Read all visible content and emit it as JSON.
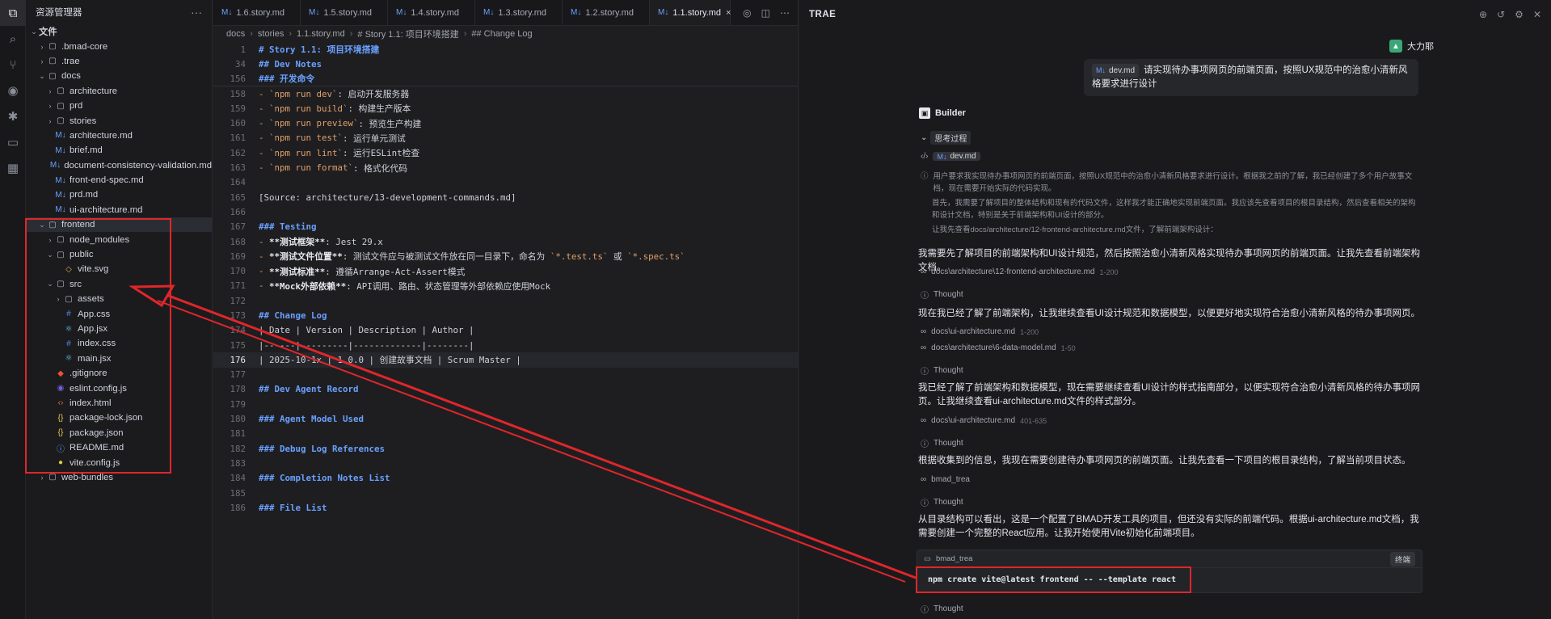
{
  "explorer": {
    "title": "资源管理器",
    "more": "···",
    "rows": [
      {
        "label": "文件",
        "indent": 0,
        "kind": "section",
        "chev": "⌄"
      },
      {
        "label": ".bmad-core",
        "indent": 1,
        "kind": "folder",
        "chev": "›"
      },
      {
        "label": ".trae",
        "indent": 1,
        "kind": "folder",
        "chev": "›"
      },
      {
        "label": "docs",
        "indent": 1,
        "kind": "folder",
        "chev": "⌄"
      },
      {
        "label": "architecture",
        "indent": 2,
        "kind": "folder",
        "chev": "›"
      },
      {
        "label": "prd",
        "indent": 2,
        "kind": "folder",
        "chev": "›"
      },
      {
        "label": "stories",
        "indent": 2,
        "kind": "folder",
        "chev": "›"
      },
      {
        "label": "architecture.md",
        "indent": 2,
        "kind": "md",
        "chev": ""
      },
      {
        "label": "brief.md",
        "indent": 2,
        "kind": "md",
        "chev": ""
      },
      {
        "label": "document-consistency-validation.md",
        "indent": 2,
        "kind": "md",
        "chev": ""
      },
      {
        "label": "front-end-spec.md",
        "indent": 2,
        "kind": "md",
        "chev": ""
      },
      {
        "label": "prd.md",
        "indent": 2,
        "kind": "md",
        "chev": ""
      },
      {
        "label": "ui-architecture.md",
        "indent": 2,
        "kind": "md",
        "chev": ""
      },
      {
        "label": "frontend",
        "indent": 1,
        "kind": "folder",
        "chev": "⌄",
        "selected": true
      },
      {
        "label": "node_modules",
        "indent": 2,
        "kind": "folder",
        "chev": "›"
      },
      {
        "label": "public",
        "indent": 2,
        "kind": "folder",
        "chev": "⌄"
      },
      {
        "label": "vite.svg",
        "indent": 3,
        "kind": "svg",
        "chev": ""
      },
      {
        "label": "src",
        "indent": 2,
        "kind": "folder",
        "chev": "⌄"
      },
      {
        "label": "assets",
        "indent": 3,
        "kind": "folder",
        "chev": "›"
      },
      {
        "label": "App.css",
        "indent": 3,
        "kind": "css",
        "chev": ""
      },
      {
        "label": "App.jsx",
        "indent": 3,
        "kind": "jsx",
        "chev": ""
      },
      {
        "label": "index.css",
        "indent": 3,
        "kind": "css",
        "chev": ""
      },
      {
        "label": "main.jsx",
        "indent": 3,
        "kind": "jsx",
        "chev": ""
      },
      {
        "label": ".gitignore",
        "indent": 2,
        "kind": "git",
        "chev": ""
      },
      {
        "label": "eslint.config.js",
        "indent": 2,
        "kind": "es",
        "chev": ""
      },
      {
        "label": "index.html",
        "indent": 2,
        "kind": "html",
        "chev": ""
      },
      {
        "label": "package-lock.json",
        "indent": 2,
        "kind": "json",
        "chev": ""
      },
      {
        "label": "package.json",
        "indent": 2,
        "kind": "json",
        "chev": ""
      },
      {
        "label": "README.md",
        "indent": 2,
        "kind": "info",
        "chev": ""
      },
      {
        "label": "vite.config.js",
        "indent": 2,
        "kind": "js",
        "chev": ""
      },
      {
        "label": "web-bundles",
        "indent": 1,
        "kind": "folder",
        "chev": "›"
      }
    ]
  },
  "editor": {
    "tabs": [
      "1.6.story.md",
      "1.5.story.md",
      "1.4.story.md",
      "1.3.story.md",
      "1.2.story.md",
      "1.1.story.md"
    ],
    "active_tab": 5,
    "tab_close": "×",
    "breadcrumbs": [
      "docs",
      "stories",
      "1.1.story.md",
      "# Story 1.1: 项目环境搭建",
      "## Change Log"
    ],
    "lines": [
      {
        "n": "1",
        "parts": [
          [
            "h",
            "# Story 1.1: 项目环境搭建"
          ]
        ]
      },
      {
        "n": "34",
        "parts": [
          [
            "h",
            "## Dev Notes"
          ]
        ]
      },
      {
        "n": "156",
        "parts": [
          [
            "h",
            "### 开发命令"
          ]
        ]
      },
      {
        "n": "158",
        "parts": [
          [
            "dash",
            "- "
          ],
          [
            "cd",
            "`npm run dev`"
          ],
          [
            "t",
            ": 启动开发服务器"
          ]
        ]
      },
      {
        "n": "159",
        "parts": [
          [
            "dash",
            "- "
          ],
          [
            "cd",
            "`npm run build`"
          ],
          [
            "t",
            ": 构建生产版本"
          ]
        ]
      },
      {
        "n": "160",
        "parts": [
          [
            "dash",
            "- "
          ],
          [
            "cd",
            "`npm run preview`"
          ],
          [
            "t",
            ": 预览生产构建"
          ]
        ]
      },
      {
        "n": "161",
        "parts": [
          [
            "dash",
            "- "
          ],
          [
            "cd",
            "`npm run test`"
          ],
          [
            "t",
            ": 运行单元测试"
          ]
        ]
      },
      {
        "n": "162",
        "parts": [
          [
            "dash",
            "- "
          ],
          [
            "cd",
            "`npm run lint`"
          ],
          [
            "t",
            ": 运行ESLint检查"
          ]
        ]
      },
      {
        "n": "163",
        "parts": [
          [
            "dash",
            "- "
          ],
          [
            "cd",
            "`npm run format`"
          ],
          [
            "t",
            ": 格式化代码"
          ]
        ]
      },
      {
        "n": "164",
        "parts": []
      },
      {
        "n": "165",
        "parts": [
          [
            "t",
            "[Source: architecture/13-development-commands.md]"
          ]
        ]
      },
      {
        "n": "166",
        "parts": []
      },
      {
        "n": "167",
        "parts": [
          [
            "h",
            "### Testing"
          ]
        ]
      },
      {
        "n": "168",
        "parts": [
          [
            "dash",
            "- "
          ],
          [
            "bold",
            "**测试框架**"
          ],
          [
            "t",
            ": Jest 29.x"
          ]
        ]
      },
      {
        "n": "169",
        "parts": [
          [
            "dash",
            "- "
          ],
          [
            "bold",
            "**测试文件位置**"
          ],
          [
            "t",
            ": 测试文件应与被测试文件放在同一目录下，命名为 "
          ],
          [
            "cd",
            "`*.test.ts`"
          ],
          [
            "t",
            " 或 "
          ],
          [
            "cd",
            "`*.spec.ts`"
          ]
        ]
      },
      {
        "n": "170",
        "parts": [
          [
            "dash",
            "- "
          ],
          [
            "bold",
            "**测试标准**"
          ],
          [
            "t",
            ": 遵循Arrange-Act-Assert模式"
          ]
        ]
      },
      {
        "n": "171",
        "parts": [
          [
            "dash",
            "- "
          ],
          [
            "bold",
            "**Mock外部依赖**"
          ],
          [
            "t",
            ": API调用、路由、状态管理等外部依赖应使用Mock"
          ]
        ]
      },
      {
        "n": "172",
        "parts": []
      },
      {
        "n": "173",
        "parts": [
          [
            "h",
            "## Change Log"
          ]
        ]
      },
      {
        "n": "174",
        "parts": [
          [
            "t",
            "| Date | Version | Description | Author |"
          ]
        ]
      },
      {
        "n": "175",
        "parts": [
          [
            "t",
            "|------|---------|-------------|--------|"
          ]
        ]
      },
      {
        "n": "176",
        "parts": [
          [
            "t",
            "| 2025-10-1x | 1.0.0 | 创建故事文档 | Scrum Master |"
          ]
        ],
        "current": true
      },
      {
        "n": "177",
        "parts": []
      },
      {
        "n": "178",
        "parts": [
          [
            "h",
            "## Dev Agent Record"
          ]
        ]
      },
      {
        "n": "179",
        "parts": []
      },
      {
        "n": "180",
        "parts": [
          [
            "h",
            "### Agent Model Used"
          ]
        ]
      },
      {
        "n": "181",
        "parts": []
      },
      {
        "n": "182",
        "parts": [
          [
            "h",
            "### Debug Log References"
          ]
        ]
      },
      {
        "n": "183",
        "parts": []
      },
      {
        "n": "184",
        "parts": [
          [
            "h",
            "### Completion Notes List"
          ]
        ]
      },
      {
        "n": "185",
        "parts": []
      },
      {
        "n": "186",
        "parts": [
          [
            "h",
            "### File List"
          ]
        ]
      }
    ]
  },
  "chat": {
    "title": "TRAE",
    "user": {
      "name": "大力耶",
      "file_chip": "dev.md",
      "message": "请实现待办事项网页的前端页面，按照UX规范中的治愈小清新风格要求进行设计"
    },
    "bot_name": "Builder",
    "thinking_label": "思考过程",
    "thinking_file": "dev.md",
    "thinking_1": "用户要求我实现待办事项网页的前端页面，按照UX规范中的治愈小清新风格要求进行设计。根据我之前的了解，我已经创建了多个用户故事文档，现在需要开始实际的代码实现。",
    "thinking_2": "首先，我需要了解项目的整体结构和现有的代码文件，这样我才能正确地实现前端页面。我应该先查看项目的根目录结构，然后查看相关的架构和设计文档，特别是关于前端架构和UI设计的部分。",
    "thinking_3": "让我先查看docs/architecture/12-frontend-architecture.md文件，了解前端架构设计：",
    "p1": "我需要先了解项目的前端架构和UI设计规范，然后按照治愈小清新风格实现待办事项网页的前端页面。让我先查看前端架构文档。",
    "ref1": "docs\\architecture\\12-frontend-architecture.md",
    "ref1_sub": "1-200",
    "thought": "Thought",
    "p2": "现在我已经了解了前端架构，让我继续查看UI设计规范和数据模型，以便更好地实现符合治愈小清新风格的待办事项网页。",
    "ref2": "docs\\ui-architecture.md",
    "ref2_sub": "1-200",
    "ref3": "docs\\architecture\\6-data-model.md",
    "ref3_sub": "1-50",
    "p3": "我已经了解了前端架构和数据模型，现在需要继续查看UI设计的样式指南部分，以便实现符合治愈小清新风格的待办事项网页。让我继续查看ui-architecture.md文件的样式部分。",
    "ref4": "docs\\ui-architecture.md",
    "ref4_sub": "401-635",
    "p4": "根据收集到的信息，我现在需要创建待办事项网页的前端页面。让我先查看一下项目的根目录结构，了解当前项目状态。",
    "ref5": "bmad_trea",
    "p5": "从目录结构可以看出，这是一个配置了BMAD开发工具的项目，但还没有实际的前端代码。根据ui-architecture.md文档，我需要创建一个完整的React应用。让我开始使用Vite初始化前端项目。",
    "terminal_name": "bmad_trea",
    "terminal_button": "终端",
    "command": "npm create vite@latest frontend -- --template react"
  },
  "colors": {
    "annotation_red": "#e0262a",
    "accent_blue": "#6aa0ff"
  }
}
